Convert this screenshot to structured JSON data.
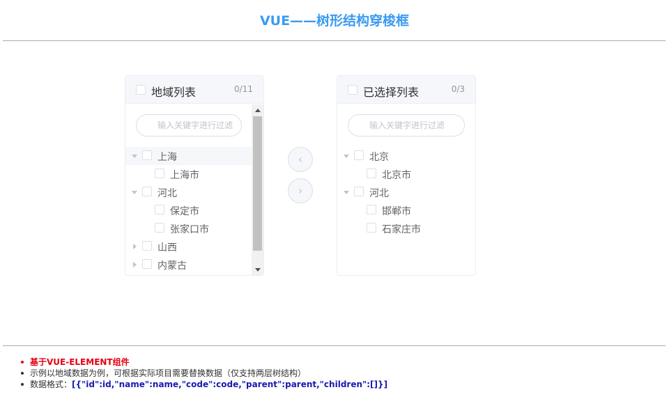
{
  "title": "VUE——树形结构穿梭框",
  "left_panel": {
    "title": "地域列表",
    "count": "0/11",
    "filter_placeholder": "输入关键字进行过滤",
    "nodes": [
      {
        "label": "上海",
        "level": 1,
        "expanded": true,
        "highlighted": true
      },
      {
        "label": "上海市",
        "level": 2
      },
      {
        "label": "河北",
        "level": 1,
        "expanded": true
      },
      {
        "label": "保定市",
        "level": 2
      },
      {
        "label": "张家口市",
        "level": 2
      },
      {
        "label": "山西",
        "level": 1,
        "expanded": false
      },
      {
        "label": "内蒙古",
        "level": 1,
        "expanded": false
      }
    ]
  },
  "right_panel": {
    "title": "已选择列表",
    "count": "0/3",
    "filter_placeholder": "输入关键字进行过滤",
    "nodes": [
      {
        "label": "北京",
        "level": 1,
        "expanded": true
      },
      {
        "label": "北京市",
        "level": 2
      },
      {
        "label": "河北",
        "level": 1,
        "expanded": true
      },
      {
        "label": "邯郸市",
        "level": 2
      },
      {
        "label": "石家庄市",
        "level": 2
      }
    ]
  },
  "buttons": {
    "to_left_icon": "‹",
    "to_right_icon": "›"
  },
  "notes": {
    "item1": "基于VUE-ELEMENT组件",
    "item2": "示例以地域数据为例，可根据实际项目需要替换数据（仅支持两层树结构）",
    "item3_prefix": "数据格式：",
    "item3_code": "[{\"id\":id,\"name\":name,\"code\":code,\"parent\":parent,\"children\":[]}]"
  },
  "colors": {
    "title": "#3a9bf0",
    "note_highlight": "#e60012",
    "code": "#1a1ab0"
  }
}
